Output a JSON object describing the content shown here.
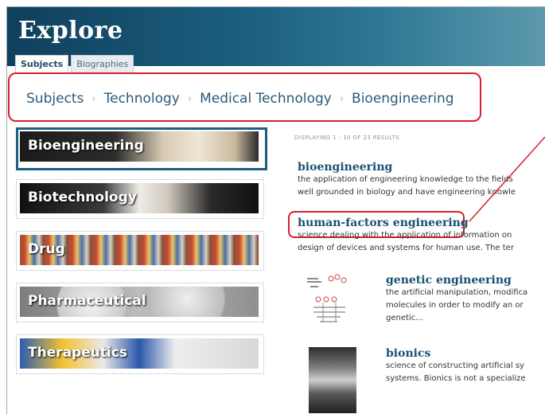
{
  "header": {
    "title": "Explore",
    "tabs": [
      "Subjects",
      "Biographies"
    ]
  },
  "breadcrumb": [
    "Subjects",
    "Technology",
    "Medical Technology",
    "Bioengineering"
  ],
  "categories": [
    {
      "label": "Bioengineering",
      "selected": true
    },
    {
      "label": "Biotechnology",
      "selected": false
    },
    {
      "label": "Drug",
      "selected": false
    },
    {
      "label": "Pharmaceutical",
      "selected": false
    },
    {
      "label": "Therapeutics",
      "selected": false
    }
  ],
  "results": {
    "count_text": "DISPLAYING 1 - 10 OF 23 RESULTS.",
    "items": [
      {
        "title": "bioengineering",
        "desc1": "the application of engineering knowledge to the fields",
        "desc2": "well grounded in biology and have engineering knowle"
      },
      {
        "title": "human-factors engineering",
        "desc1": "science dealing with the application of information on",
        "desc2": "design of devices and systems for human use. The ter"
      },
      {
        "title": "genetic engineering",
        "desc1": "the artificial manipulation, modifica",
        "desc2": "molecules in order to modify an or",
        "desc3": "genetic..."
      },
      {
        "title": "bionics",
        "desc1": "science of constructing artificial sy",
        "desc2": "systems. Bionics is not a specialize"
      }
    ]
  },
  "colors": {
    "accent": "#1c5f80",
    "highlight": "#d6202a",
    "link": "#1a4f73"
  }
}
